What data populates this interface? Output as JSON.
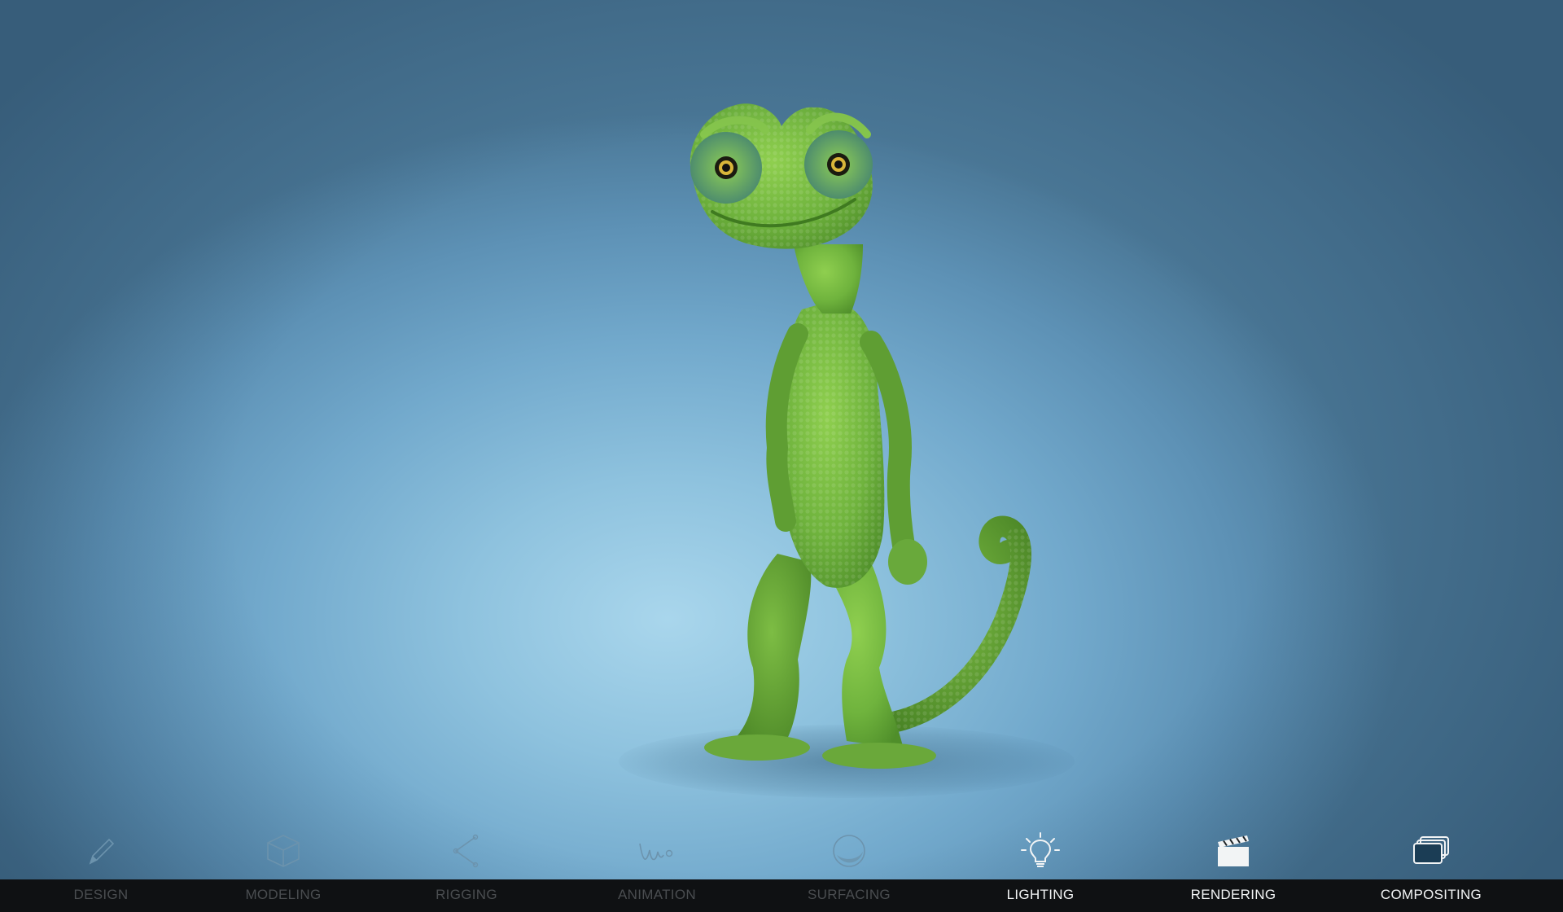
{
  "scene": {
    "subject": "chameleon-character"
  },
  "toolbar": {
    "items": [
      {
        "label": "DESIGN",
        "icon": "pencil-icon",
        "active": false
      },
      {
        "label": "MODELING",
        "icon": "cube-icon",
        "active": false
      },
      {
        "label": "RIGGING",
        "icon": "rig-joint-icon",
        "active": false
      },
      {
        "label": "ANIMATION",
        "icon": "motion-curve-icon",
        "active": false
      },
      {
        "label": "SURFACING",
        "icon": "sphere-icon",
        "active": false
      },
      {
        "label": "LIGHTING",
        "icon": "lightbulb-icon",
        "active": true
      },
      {
        "label": "RENDERING",
        "icon": "clapperboard-icon",
        "active": true
      },
      {
        "label": "COMPOSITING",
        "icon": "layers-icon",
        "active": true
      }
    ]
  },
  "colors": {
    "background_light": "#a9d6ec",
    "background_dark": "#4a7796",
    "toolbar_band": "#0f1113",
    "label_active": "#f2f4f5",
    "label_inactive": "#4a4d50",
    "chameleon_green": "#6fb33d"
  }
}
